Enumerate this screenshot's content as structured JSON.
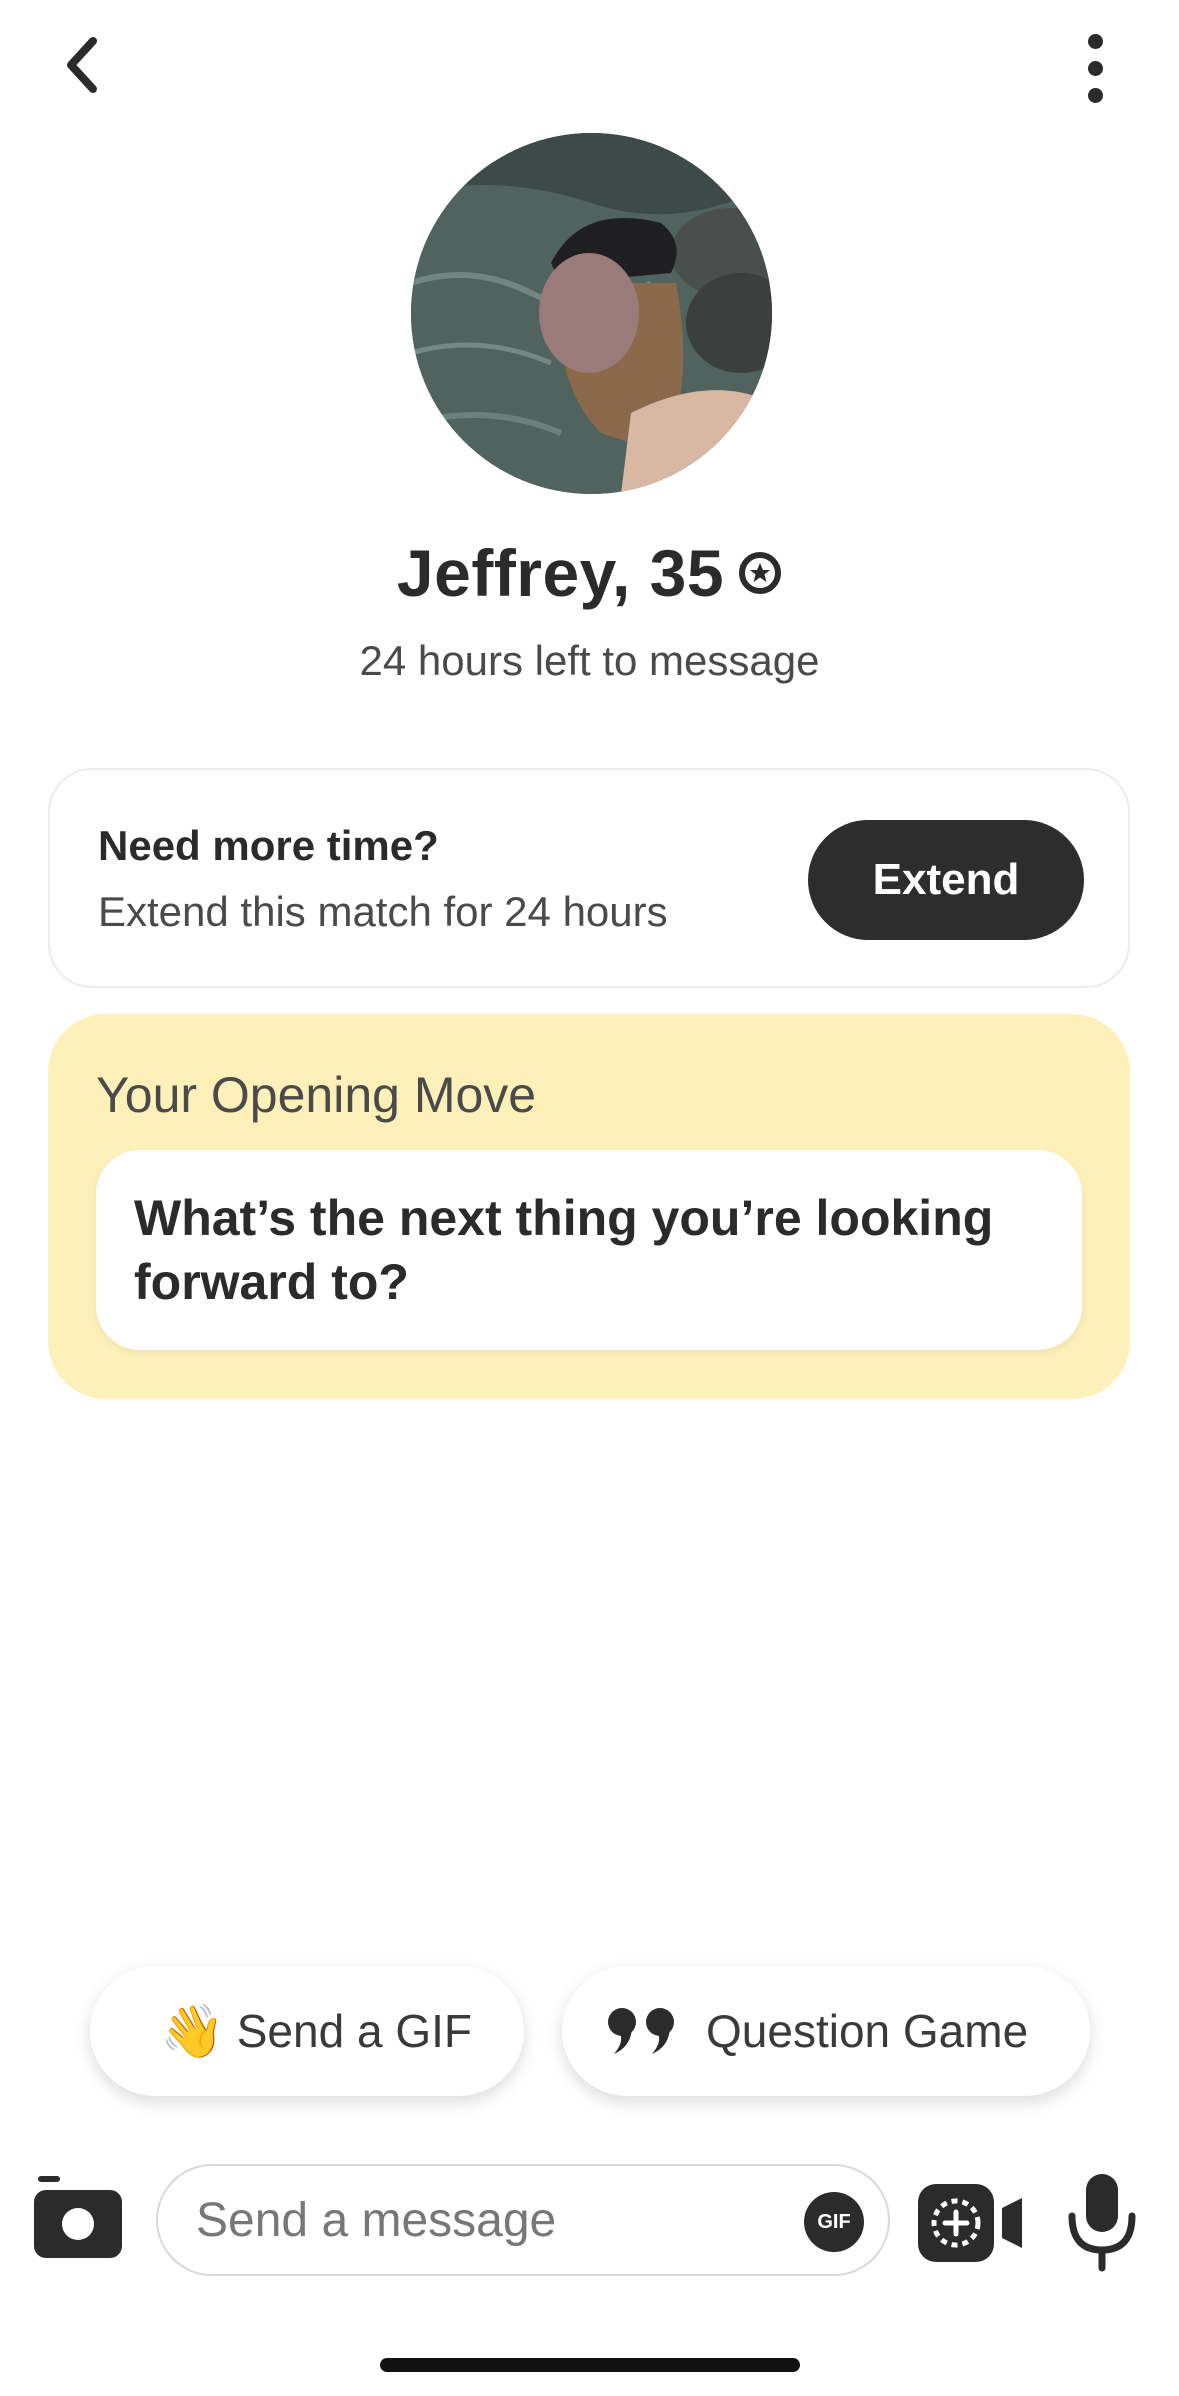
{
  "header": {
    "back_icon": "chevron-left-icon",
    "more_icon": "vertical-ellipsis-icon"
  },
  "profile": {
    "name": "Jeffrey, 35",
    "verified_icon": "verified-badge-icon",
    "time_left": "24 hours left to message"
  },
  "extend_card": {
    "title": "Need more time?",
    "subtitle": "Extend this match for 24 hours",
    "button_label": "Extend"
  },
  "opening_move": {
    "label": "Your Opening Move",
    "question": "What’s the next thing you’re looking forward to?"
  },
  "suggestions": {
    "gif_emoji": "👋",
    "gif_label": "Send a GIF",
    "question_icon": "quote-icon",
    "question_label": "Question Game"
  },
  "composer": {
    "camera_icon": "camera-icon",
    "placeholder": "Send a message",
    "gif_badge": "GIF",
    "video_icon": "video-call-icon",
    "mic_icon": "microphone-icon"
  },
  "colors": {
    "text_primary": "#2b2b2b",
    "opening_move_bg": "#fdf0b8",
    "extend_button_bg": "#2d2d2d"
  }
}
